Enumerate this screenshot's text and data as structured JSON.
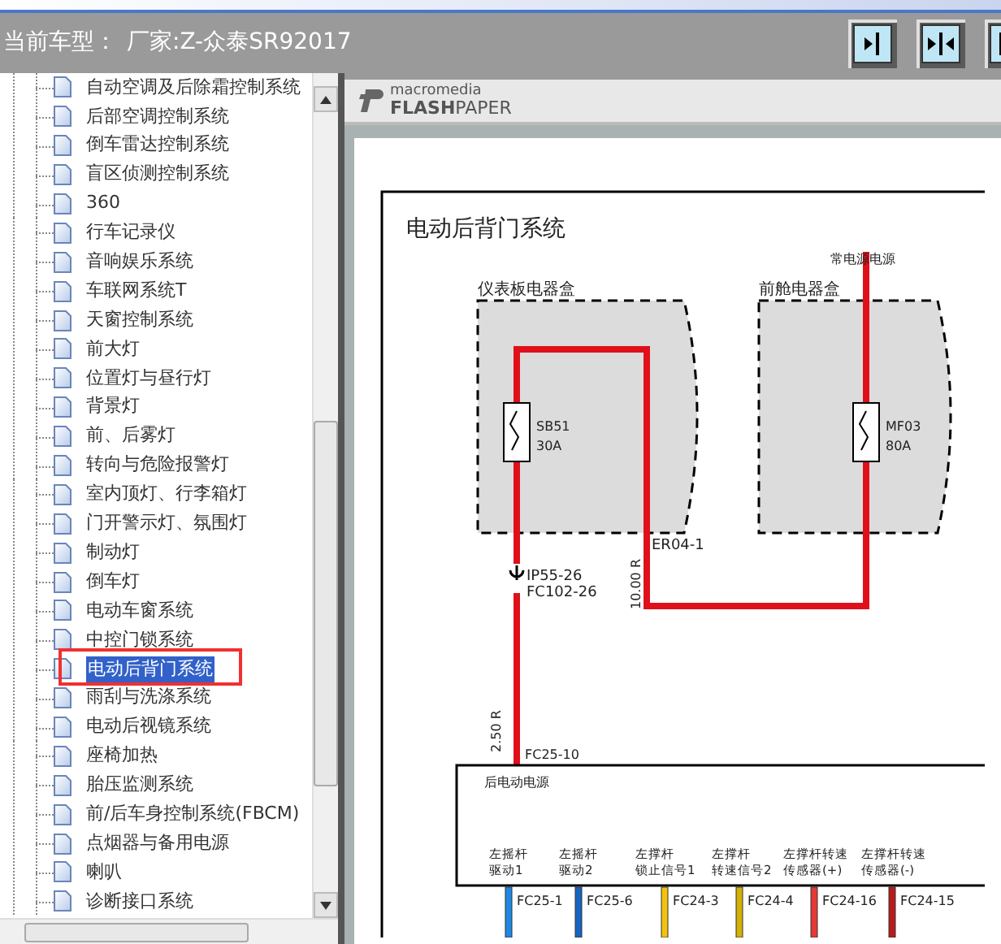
{
  "toolbar": {
    "model_label": "当前车型：",
    "model_value": "厂家:Z-众泰SR92017"
  },
  "tree": {
    "items": [
      {
        "label": "自动空调及后除霜控制系统",
        "selected": false
      },
      {
        "label": "后部空调控制系统",
        "selected": false
      },
      {
        "label": "倒车雷达控制系统",
        "selected": false
      },
      {
        "label": "盲区侦测控制系统",
        "selected": false
      },
      {
        "label": "360",
        "selected": false
      },
      {
        "label": "行车记录仪",
        "selected": false
      },
      {
        "label": "音响娱乐系统",
        "selected": false
      },
      {
        "label": "车联网系统T",
        "selected": false
      },
      {
        "label": "天窗控制系统",
        "selected": false
      },
      {
        "label": "前大灯",
        "selected": false
      },
      {
        "label": "位置灯与昼行灯",
        "selected": false
      },
      {
        "label": "背景灯",
        "selected": false
      },
      {
        "label": "前、后雾灯",
        "selected": false
      },
      {
        "label": "转向与危险报警灯",
        "selected": false
      },
      {
        "label": "室内顶灯、行李箱灯",
        "selected": false
      },
      {
        "label": "门开警示灯、氛围灯",
        "selected": false
      },
      {
        "label": "制动灯",
        "selected": false
      },
      {
        "label": "倒车灯",
        "selected": false
      },
      {
        "label": "电动车窗系统",
        "selected": false
      },
      {
        "label": "中控门锁系统",
        "selected": false
      },
      {
        "label": "电动后背门系统",
        "selected": true
      },
      {
        "label": "雨刮与洗涤系统",
        "selected": false
      },
      {
        "label": "电动后视镜系统",
        "selected": false
      },
      {
        "label": "座椅加热",
        "selected": false
      },
      {
        "label": "胎压监测系统",
        "selected": false
      },
      {
        "label": "前/后车身控制系统(FBCM)",
        "selected": false
      },
      {
        "label": "点烟器与备用电源",
        "selected": false
      },
      {
        "label": "喇叭",
        "selected": false
      },
      {
        "label": "诊断接口系统",
        "selected": false
      }
    ]
  },
  "viewer": {
    "brand_top": "macromedia",
    "brand_bold": "FLASH",
    "brand_rest": "PAPER",
    "diagram": {
      "title": "电动后背门系统",
      "supply_label": "常电源电源",
      "boxes": [
        {
          "label": "仪表板电器盒",
          "fuse": "SB51",
          "rating": "30A"
        },
        {
          "label": "前舱电器盒",
          "fuse": "MF03",
          "rating": "80A"
        }
      ],
      "connector_1": "ER04-1",
      "wire_1": "10.00 R",
      "connector_2a": "IP55-26",
      "connector_2b": "FC102-26",
      "wire_2": "2.50 R",
      "connector_3": "FC25-10",
      "module": "后电动电源",
      "pins": [
        {
          "lines": [
            "左摇杆",
            "驱动1"
          ],
          "pin": "FC25-1",
          "color": "#1e88e5"
        },
        {
          "lines": [
            "左摇杆",
            "驱动2"
          ],
          "pin": "FC25-6",
          "color": "#1565c0"
        },
        {
          "lines": [
            "左撑杆",
            "锁止信号1"
          ],
          "pin": "FC24-3",
          "color": "#f4c20d"
        },
        {
          "lines": [
            "左撑杆",
            "转速信号2"
          ],
          "pin": "FC24-4",
          "color": "#d4b106"
        },
        {
          "lines": [
            "左撑杆转速",
            "传感器(+)"
          ],
          "pin": "FC24-16",
          "color": "#e53935"
        },
        {
          "lines": [
            "左撑杆转速",
            "传感器(-)"
          ],
          "pin": "FC24-15",
          "color": "#b71c1c"
        }
      ]
    }
  }
}
